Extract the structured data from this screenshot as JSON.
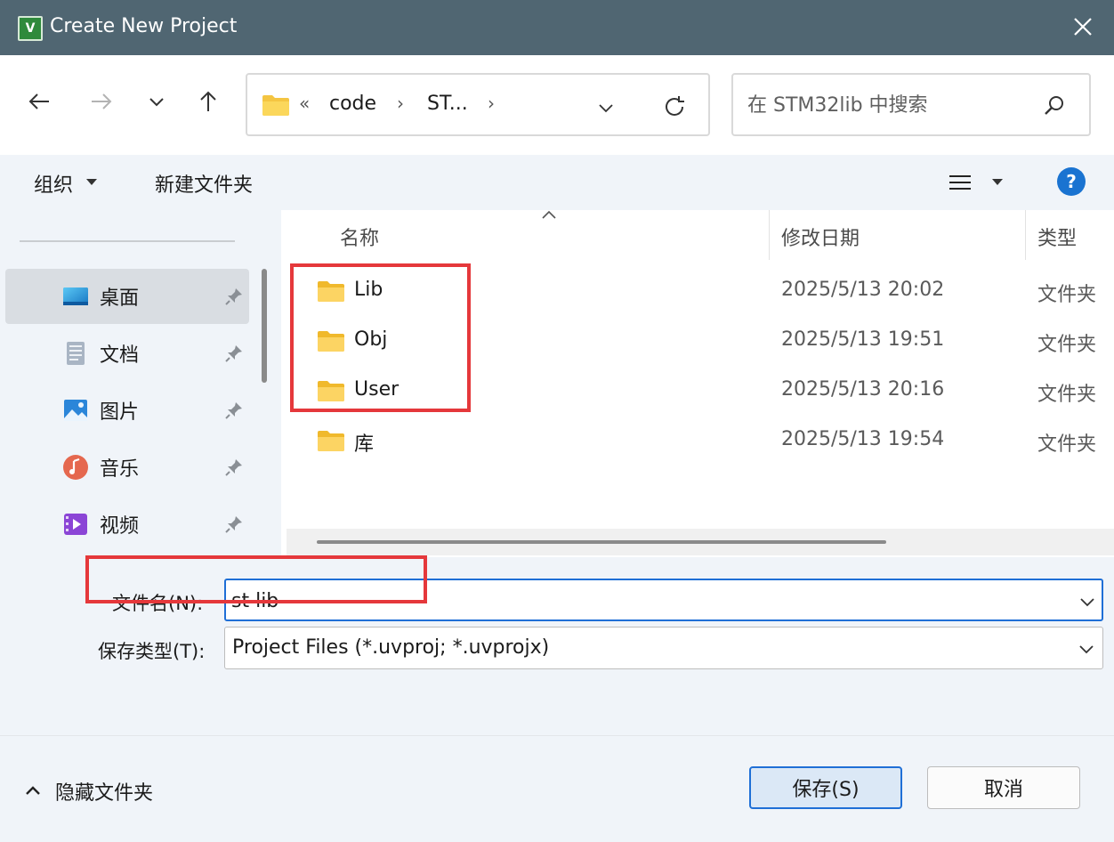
{
  "window": {
    "title": "Create New Project",
    "app_icon_text": "V"
  },
  "nav": {
    "breadcrumb": [
      "code",
      "ST..."
    ],
    "breadcrumb_overflow": "«",
    "search_placeholder": "在 STM32lib 中搜索"
  },
  "toolbar": {
    "organize_label": "组织",
    "new_folder_label": "新建文件夹",
    "help_label": "?"
  },
  "sidebar": {
    "items": [
      {
        "label": "桌面",
        "icon": "desktop-icon",
        "pinned": true,
        "selected": true
      },
      {
        "label": "文档",
        "icon": "document-icon",
        "pinned": true,
        "selected": false
      },
      {
        "label": "图片",
        "icon": "pictures-icon",
        "pinned": true,
        "selected": false
      },
      {
        "label": "音乐",
        "icon": "music-icon",
        "pinned": true,
        "selected": false
      },
      {
        "label": "视频",
        "icon": "video-icon",
        "pinned": true,
        "selected": false
      }
    ]
  },
  "columns": {
    "name": "名称",
    "date": "修改日期",
    "type": "类型"
  },
  "files": [
    {
      "name": "Lib",
      "date": "2025/5/13 20:02",
      "type": "文件夹"
    },
    {
      "name": "Obj",
      "date": "2025/5/13 19:51",
      "type": "文件夹"
    },
    {
      "name": "User",
      "date": "2025/5/13 20:16",
      "type": "文件夹"
    },
    {
      "name": "库",
      "date": "2025/5/13 19:54",
      "type": "文件夹"
    }
  ],
  "form": {
    "filename_label": "文件名(N):",
    "filename_value": "st lib",
    "filetype_label": "保存类型(T):",
    "filetype_value": "Project Files (*.uvproj; *.uvprojx)"
  },
  "footer": {
    "hide_folders_label": "隐藏文件夹",
    "save_label": "保存(S)",
    "cancel_label": "取消"
  },
  "colors": {
    "titlebar": "#506672",
    "accent": "#1f6fd6",
    "highlight": "#e5383b",
    "folder": "#f4c542"
  }
}
